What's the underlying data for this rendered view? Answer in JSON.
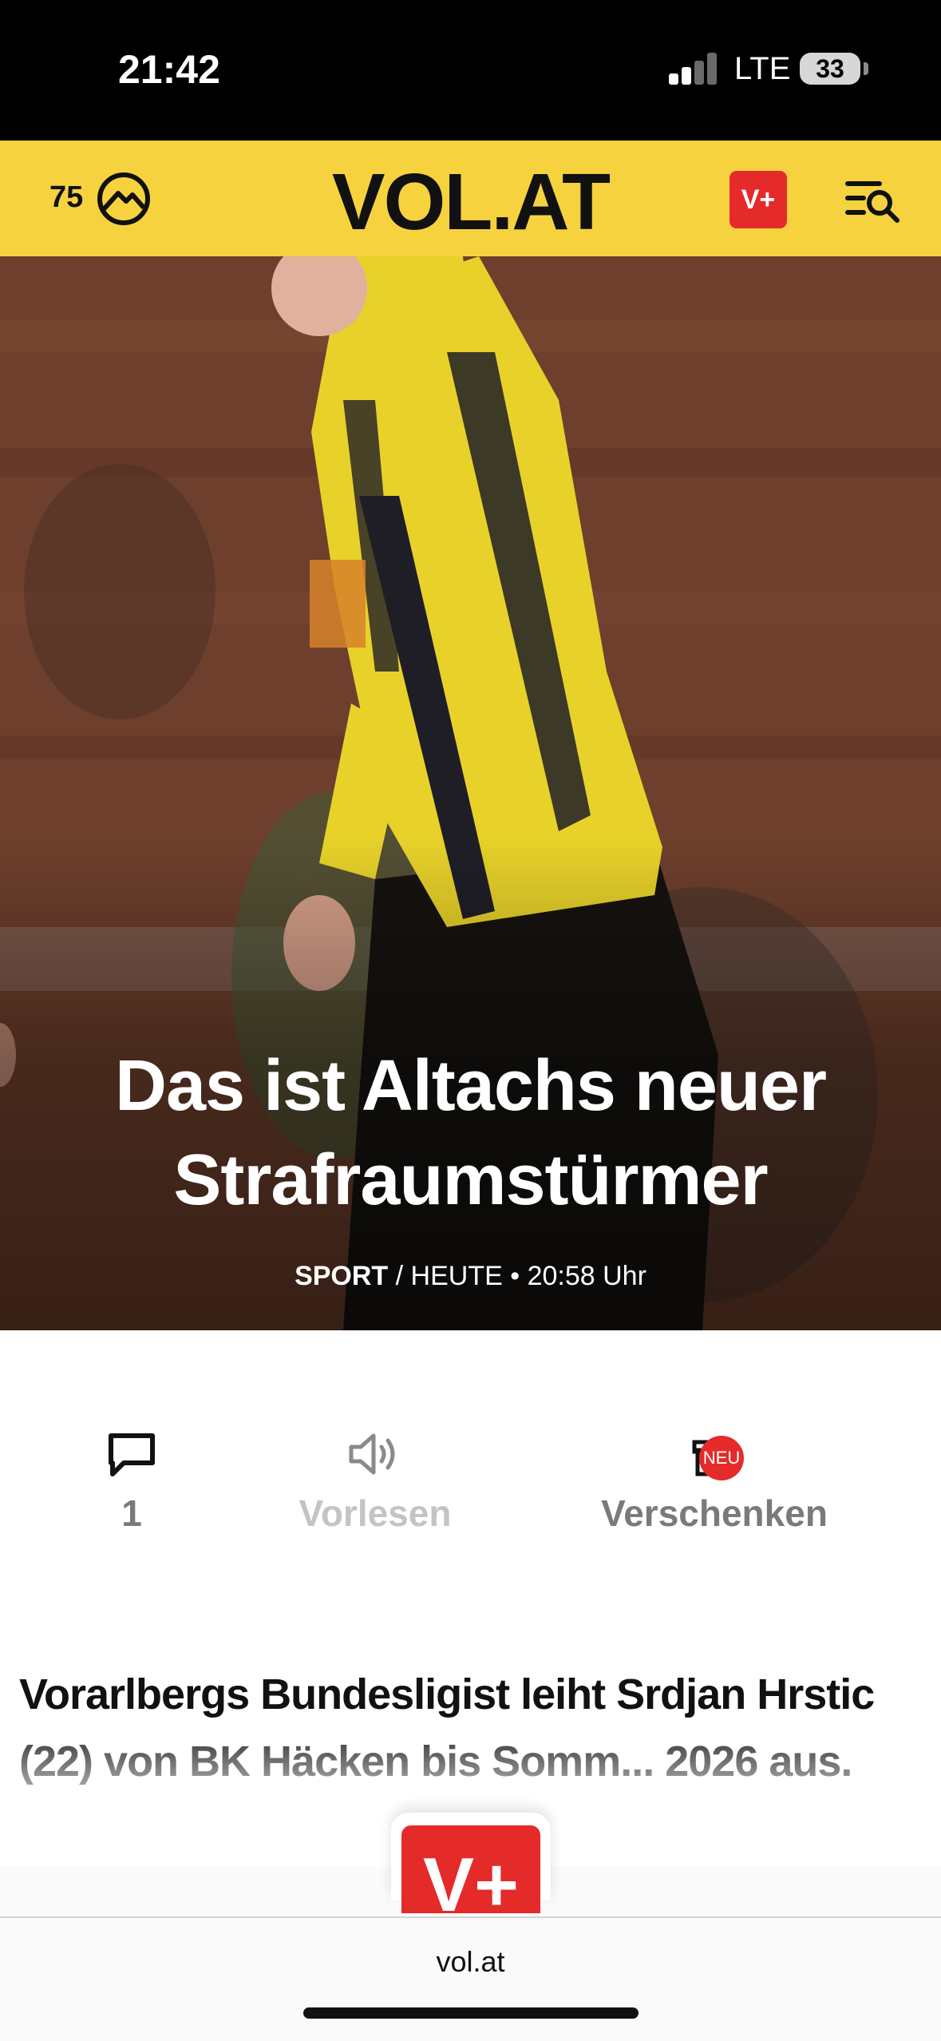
{
  "status_bar": {
    "time": "21:42",
    "network": "LTE",
    "battery": "33"
  },
  "header": {
    "temperature": "75",
    "weather_icon": "mountain-sun-icon",
    "logo": "VOL.AT",
    "vplus_label": "V+",
    "menu_icon": "menu-search-icon"
  },
  "hero": {
    "title": "Das ist Altachs neuer Strafraumstürmer",
    "category": "SPORT",
    "separator": " / ",
    "date": "HEUTE",
    "dot": " • ",
    "time": "20:58 Uhr"
  },
  "actions": {
    "comments_count": "1",
    "comments_icon": "comment-icon",
    "read_label": "Vorlesen",
    "read_icon": "speaker-icon",
    "gift_label": "Verschenken",
    "gift_icon": "gift-icon",
    "new_badge": "NEU"
  },
  "article": {
    "lead": "Vorarlbergs Bundesligist leiht Srdjan Hrstic (22) von BK Häcken bis Somm... 2026 aus."
  },
  "floating": {
    "vplus_label": "V+"
  },
  "browser": {
    "url": "vol.at"
  },
  "colors": {
    "header_yellow": "#f6d23f",
    "brand_red": "#e52a2a",
    "disabled_gray": "#c4c4c4",
    "label_gray": "#7a7a7a"
  }
}
